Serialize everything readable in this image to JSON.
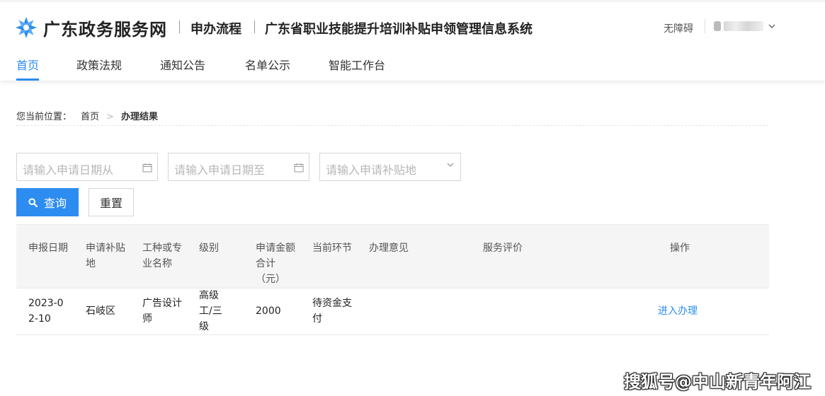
{
  "header": {
    "site_name": "广东政务服务网",
    "section": "申办流程",
    "system_name": "广东省职业技能提升培训补贴申领管理信息系统",
    "accessibility": "无障碍"
  },
  "nav": {
    "items": [
      {
        "label": "首页",
        "active": true
      },
      {
        "label": "政策法规"
      },
      {
        "label": "通知公告"
      },
      {
        "label": "名单公示"
      },
      {
        "label": "智能工作台"
      }
    ]
  },
  "breadcrumb": {
    "prefix": "您当前位置：",
    "home": "首页",
    "separator": ">",
    "current": "办理结果"
  },
  "filters": {
    "date_from_placeholder": "请输入申请日期从",
    "date_to_placeholder": "请输入申请日期至",
    "region_placeholder": "请输入申请补贴地",
    "query_label": "查询",
    "reset_label": "重置"
  },
  "table": {
    "headers": [
      "申报日期",
      "申请补贴地",
      "工种或专业名称",
      "级别",
      "申请金额合计（元）",
      "当前环节",
      "办理意见",
      "服务评价",
      "操作"
    ],
    "rows": [
      {
        "date": "2023-02-10",
        "region": "石岐区",
        "occupation": "广告设计师",
        "level": "高级工/三级",
        "amount": "2000",
        "stage": "待资金支付",
        "opinion": "",
        "evaluation": "",
        "action": "进入办理"
      }
    ]
  },
  "watermark": "搜狐号@中山新青年阿江",
  "colors": {
    "accent": "#2d8cf0",
    "text": "#333333",
    "placeholder": "#b7b7b7",
    "table_header_bg": "#f5f5f5"
  }
}
